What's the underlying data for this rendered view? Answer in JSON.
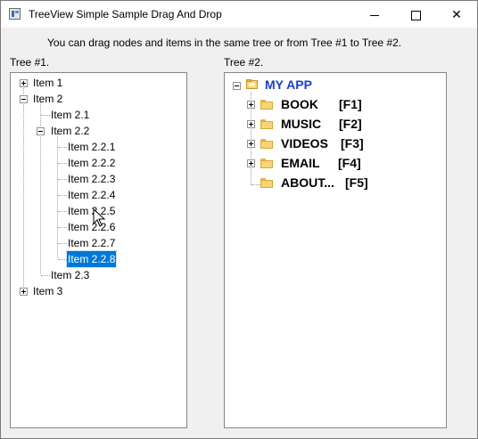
{
  "window": {
    "title": "TreeView Simple Sample Drag And Drop"
  },
  "instructions": "You can drag nodes and items in the same tree or from Tree #1 to Tree #2.",
  "tree1": {
    "label": "Tree #1.",
    "items": [
      {
        "label": "Item 1"
      },
      {
        "label": "Item 2"
      },
      {
        "label": "Item 2.1"
      },
      {
        "label": "Item 2.2"
      },
      {
        "label": "Item 2.2.1"
      },
      {
        "label": "Item 2.2.2"
      },
      {
        "label": "Item 2.2.3"
      },
      {
        "label": "Item 2.2.4"
      },
      {
        "label": "Item 2.2.5"
      },
      {
        "label": "Item 2.2.6"
      },
      {
        "label": "Item 2.2.7"
      },
      {
        "label": "Item 2.2.8"
      },
      {
        "label": "Item 2.3"
      },
      {
        "label": "Item 3"
      }
    ],
    "selected": "Item 2.2.8"
  },
  "tree2": {
    "label": "Tree #2.",
    "root": "MY APP",
    "items": [
      {
        "name": "BOOK",
        "key": "[F1]"
      },
      {
        "name": "MUSIC",
        "key": "[F2]"
      },
      {
        "name": "VIDEOS",
        "key": "[F3]"
      },
      {
        "name": "EMAIL",
        "key": "[F4]"
      },
      {
        "name": "ABOUT...",
        "key": "[F5]"
      }
    ]
  },
  "colors": {
    "selection": "#0078d7",
    "root_text": "#1a3fd1",
    "folder": "#f7d475"
  }
}
